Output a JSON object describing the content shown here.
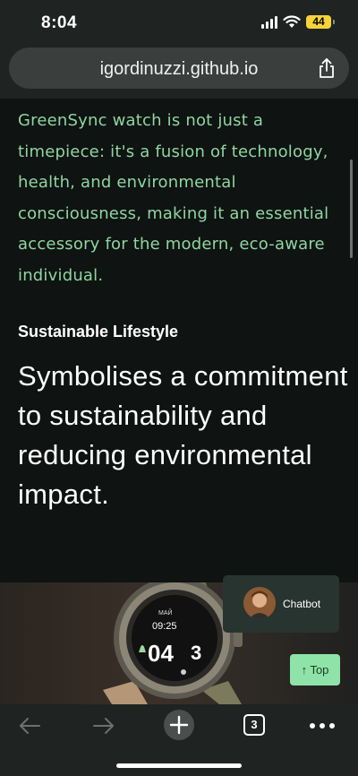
{
  "status": {
    "time": "8:04",
    "battery": "44"
  },
  "browser": {
    "url": "igordinuzzi.github.io",
    "tab_count": "3"
  },
  "page": {
    "intro": "GreenSync watch is not just a timepiece: it's a fusion of technology, health, and environmental consciousness, making it an essential accessory for the modern, eco-aware individual.",
    "section_label": "Sustainable Lifestyle",
    "section_heading": "Symbolises a commitment to sustainability and reducing environmental impact."
  },
  "chatbot": {
    "label": "Chatbot"
  },
  "top_button": {
    "label": "↑ Top"
  },
  "watch_display": {
    "time": "09:25",
    "small": "МАЙ",
    "date": "04",
    "num": "3"
  },
  "colors": {
    "accent": "#8fd6a0",
    "top_button": "#8fe3a8",
    "background": "#0f1312"
  }
}
